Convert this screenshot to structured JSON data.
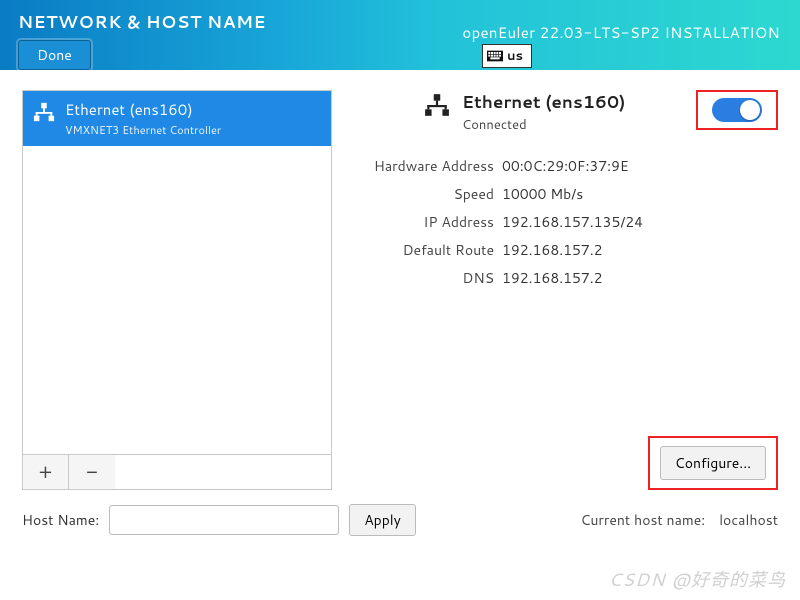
{
  "header": {
    "title": "NETWORK & HOST NAME",
    "installer": "openEuler 22.03-LTS-SP2 INSTALLATION",
    "done": "Done",
    "keyboard": "us"
  },
  "nic_list": [
    {
      "name": "Ethernet (ens160)",
      "desc": "VMXNET3 Ethernet Controller"
    }
  ],
  "buttons": {
    "add": "+",
    "remove": "−",
    "configure": "Configure...",
    "apply": "Apply"
  },
  "selected": {
    "title": "Ethernet (ens160)",
    "status": "Connected",
    "enabled": true
  },
  "details": {
    "hw_label": "Hardware Address",
    "hw": "00:0C:29:0F:37:9E",
    "speed_label": "Speed",
    "speed": "10000 Mb/s",
    "ip_label": "IP Address",
    "ip": "192.168.157.135/24",
    "route_label": "Default Route",
    "route": "192.168.157.2",
    "dns_label": "DNS",
    "dns": "192.168.157.2"
  },
  "hostname": {
    "label": "Host Name:",
    "value": "",
    "current_label": "Current host name:",
    "current": "localhost"
  },
  "watermark": "CSDN @好奇的菜鸟"
}
